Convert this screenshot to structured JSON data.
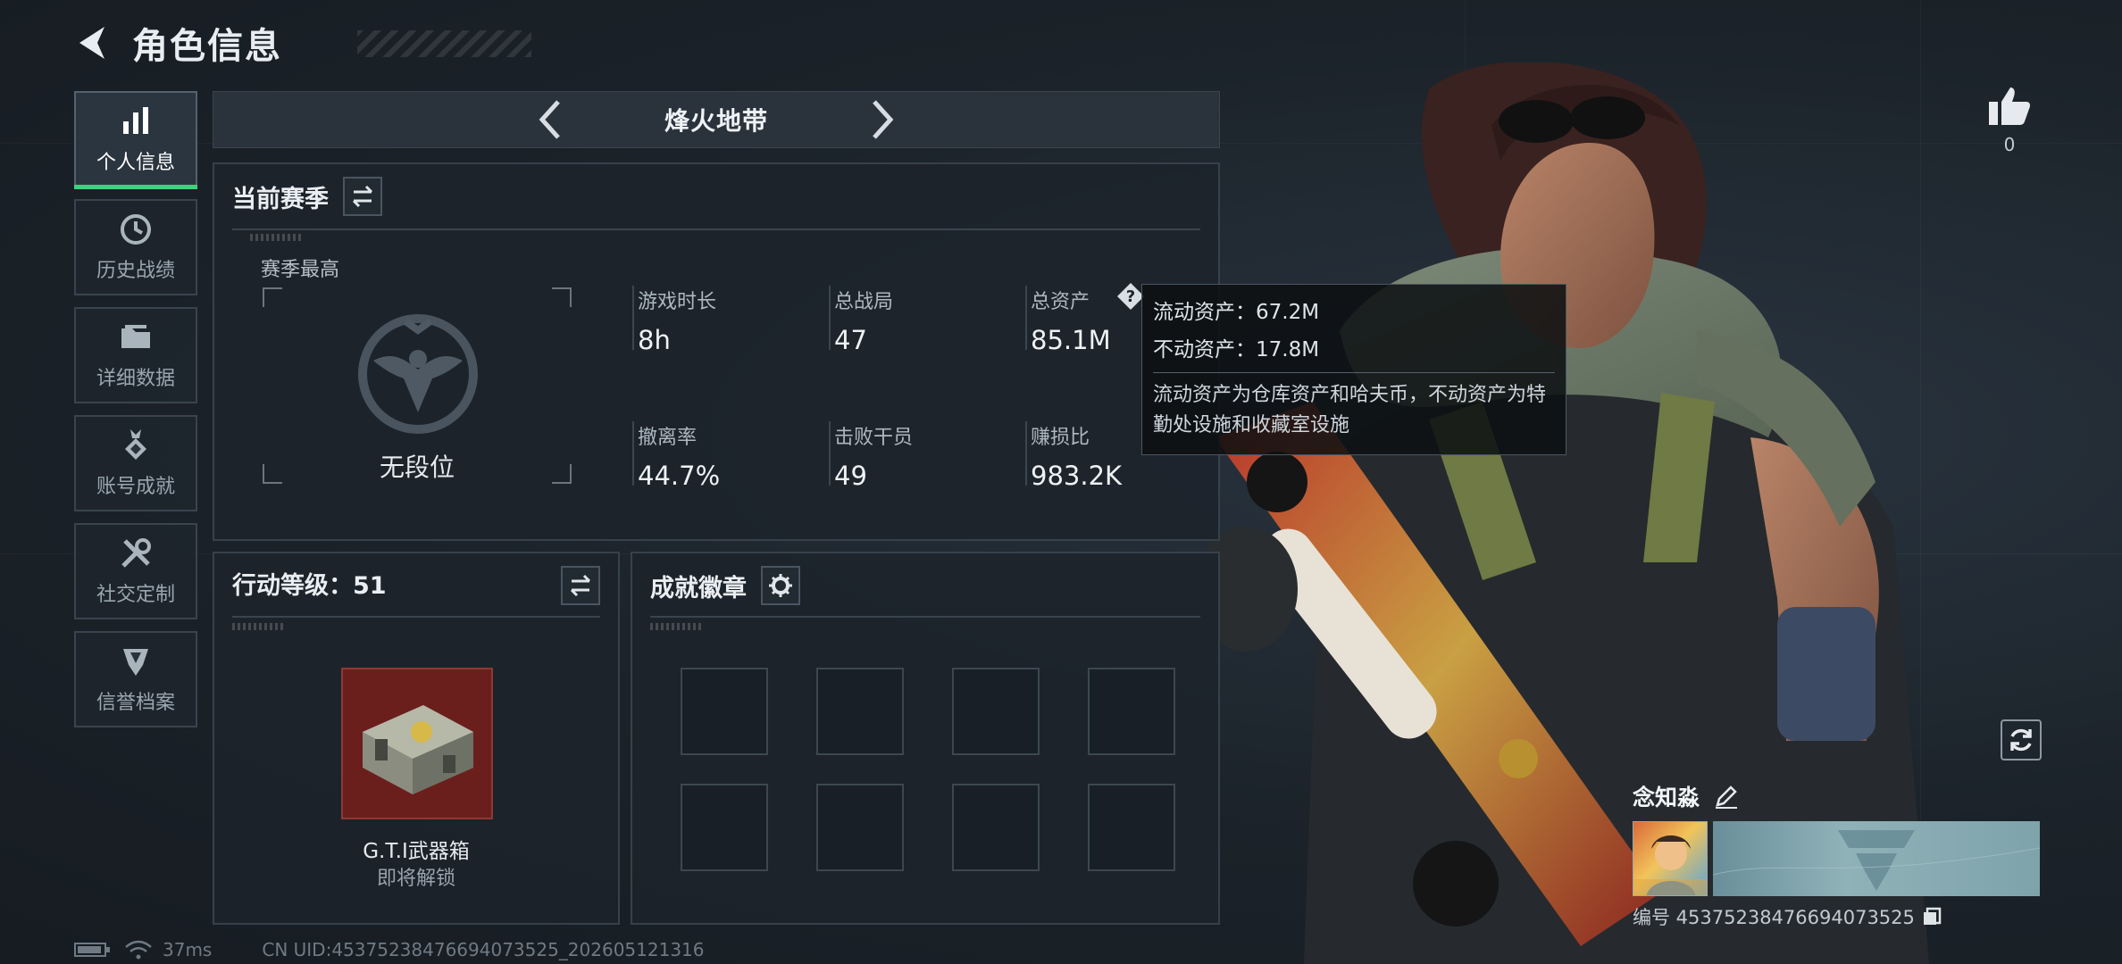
{
  "header": {
    "title": "角色信息"
  },
  "sidebar": {
    "items": [
      {
        "label": "个人信息",
        "icon": "bar-chart-icon",
        "active": true
      },
      {
        "label": "历史战绩",
        "icon": "history-clock-icon",
        "active": false
      },
      {
        "label": "详细数据",
        "icon": "folder-icon",
        "active": false
      },
      {
        "label": "账号成就",
        "icon": "medal-icon",
        "active": false
      },
      {
        "label": "社交定制",
        "icon": "tools-icon",
        "active": false
      },
      {
        "label": "信誉档案",
        "icon": "shield-icon",
        "active": false
      }
    ]
  },
  "mode": {
    "title": "烽火地带"
  },
  "season": {
    "title": "当前赛季",
    "rank_label": "赛季最高",
    "rank_name": "无段位",
    "stats": [
      {
        "label": "游戏时长",
        "value": "8h"
      },
      {
        "label": "总战局",
        "value": "47"
      },
      {
        "label": "总资产",
        "value": "85.1M"
      },
      {
        "label": "撤离率",
        "value": "44.7%"
      },
      {
        "label": "击败干员",
        "value": "49"
      },
      {
        "label": "赚损比",
        "value": "983.2K"
      }
    ]
  },
  "tooltip": {
    "liquid": "流动资产：67.2M",
    "fixed": "不动资产：17.8M",
    "note": "流动资产为仓库资产和哈夫币，不动资产为特勤处设施和收藏室设施"
  },
  "level": {
    "title": "行动等级：51",
    "reward_name": "G.T.I武器箱",
    "reward_status": "即将解锁"
  },
  "badges": {
    "title": "成就徽章",
    "slots": 8
  },
  "likes": {
    "count": "0"
  },
  "player": {
    "name": "念知淼",
    "id_text": "编号 453752384766940735​25"
  },
  "status": {
    "ping": "37ms",
    "uid": "CN UID:45375238476694073525_202605121316"
  },
  "colors": {
    "accent_green": "#3bd27e",
    "reward_bg": "#6b1f1c"
  }
}
